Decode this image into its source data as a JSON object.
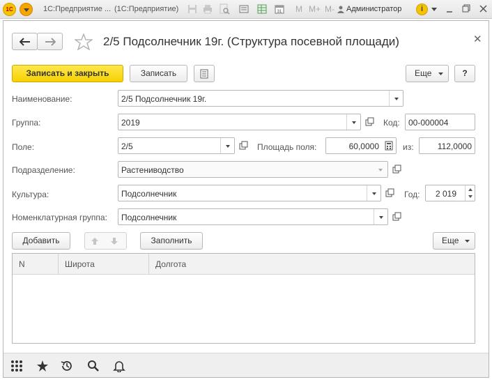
{
  "titlebar": {
    "logo_text": "1С",
    "app_title": "1С:Предприятие ...",
    "app_subtitle": "(1С:Предприятие)",
    "m_labels": [
      "M",
      "M+",
      "M-"
    ],
    "user": "Администратор",
    "info_label": "i"
  },
  "form": {
    "title": "2/5 Подсолнечник 19г. (Структура посевной площади)"
  },
  "toolbar": {
    "save_close_label": "Записать и закрыть",
    "save_label": "Записать",
    "more_label": "Еще",
    "help_label": "?"
  },
  "fields": {
    "name_label": "Наименование:",
    "name_value": "2/5 Подсолнечник 19г.",
    "group_label": "Группа:",
    "group_value": "2019",
    "code_label": "Код:",
    "code_value": "00-000004",
    "field_label": "Поле:",
    "field_value": "2/5",
    "area_label": "Площадь поля:",
    "area_value": "60,0000",
    "of_label": "из:",
    "of_value": "112,0000",
    "division_label": "Подразделение:",
    "division_value": "Растениводство",
    "crop_label": "Культура:",
    "crop_value": "Подсолнечник",
    "year_label": "Год:",
    "year_value": "2 019",
    "nomenclature_label": "Номенклатурная группа:",
    "nomenclature_value": "Подсолнечник"
  },
  "table_toolbar": {
    "add_label": "Добавить",
    "fill_label": "Заполнить",
    "more_label": "Еще"
  },
  "table": {
    "columns": [
      "N",
      "Широта",
      "Долгота"
    ]
  }
}
